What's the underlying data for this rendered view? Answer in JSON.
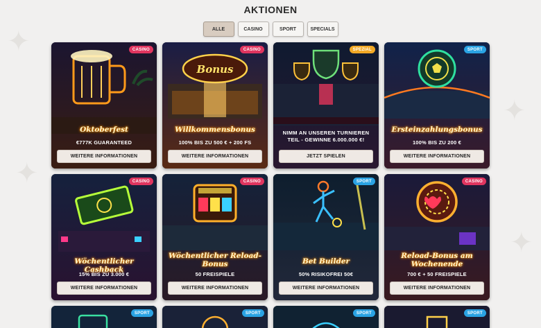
{
  "page": {
    "title": "AKTIONEN"
  },
  "filters": [
    {
      "label": "ALLE",
      "active": true
    },
    {
      "label": "CASINO",
      "active": false
    },
    {
      "label": "SPORT",
      "active": false
    },
    {
      "label": "SPECIALS",
      "active": false
    }
  ],
  "cards": [
    {
      "badge": "CASINO",
      "title": "Oktoberfest",
      "subtitle": "€777K GUARANTEED",
      "button": "WEITERE INFORMATIONEN",
      "icon": "beer-mug-icon"
    },
    {
      "badge": "CASINO",
      "title": "Willkommensbonus",
      "subtitle": "100% BIS ZU 500 € + 200 FS",
      "button": "WEITERE INFORMATIONEN",
      "icon": "bonus-sign-icon",
      "sign_text": "Bonus"
    },
    {
      "badge": "SPEZIAL",
      "title": "NIMM AN UNSEREN TURNIEREN TEIL - GEWINNE 6.000.000 €!",
      "subtitle": "",
      "button": "JETZT SPIELEN",
      "icon": "trophy-icon"
    },
    {
      "badge": "SPORT",
      "title": "Ersteinzahlungsbonus",
      "subtitle": "100% BIS ZU 200 €",
      "button": "WEITERE INFORMATIONEN",
      "icon": "football-icon"
    },
    {
      "badge": "CASINO",
      "title": "Wöchentlicher Cashback",
      "subtitle": "15% BIS ZU 3.000 €",
      "button": "WEITERE INFORMATIONEN",
      "icon": "cash-icon"
    },
    {
      "badge": "CASINO",
      "title": "Wöchentlicher Reload-Bonus",
      "subtitle": "50 FREISPIELE",
      "button": "WEITERE INFORMATIONEN",
      "icon": "slot-machine-icon"
    },
    {
      "badge": "SPORT",
      "title": "Bet Builder",
      "subtitle": "50% RISIKOFREI 50€",
      "button": "WEITERE INFORMATIONEN",
      "icon": "football-player-icon"
    },
    {
      "badge": "CASINO",
      "title": "Reload-Bonus am Wochenende",
      "subtitle": "700 € + 50 FREISPIELE",
      "button": "WEITERE INFORMATIONEN",
      "icon": "casino-chip-icon"
    }
  ],
  "partial_cards": [
    {
      "badge": "SPORT"
    },
    {
      "badge": "SPORT"
    },
    {
      "badge": "SPORT"
    },
    {
      "badge": "SPORT"
    }
  ],
  "colors": {
    "background": "#f1f0ef",
    "casino_badge": "#e0355f",
    "sport_badge": "#2aa3e3",
    "spezial_badge": "#f2a926",
    "active_filter": "#d8ccc0"
  }
}
